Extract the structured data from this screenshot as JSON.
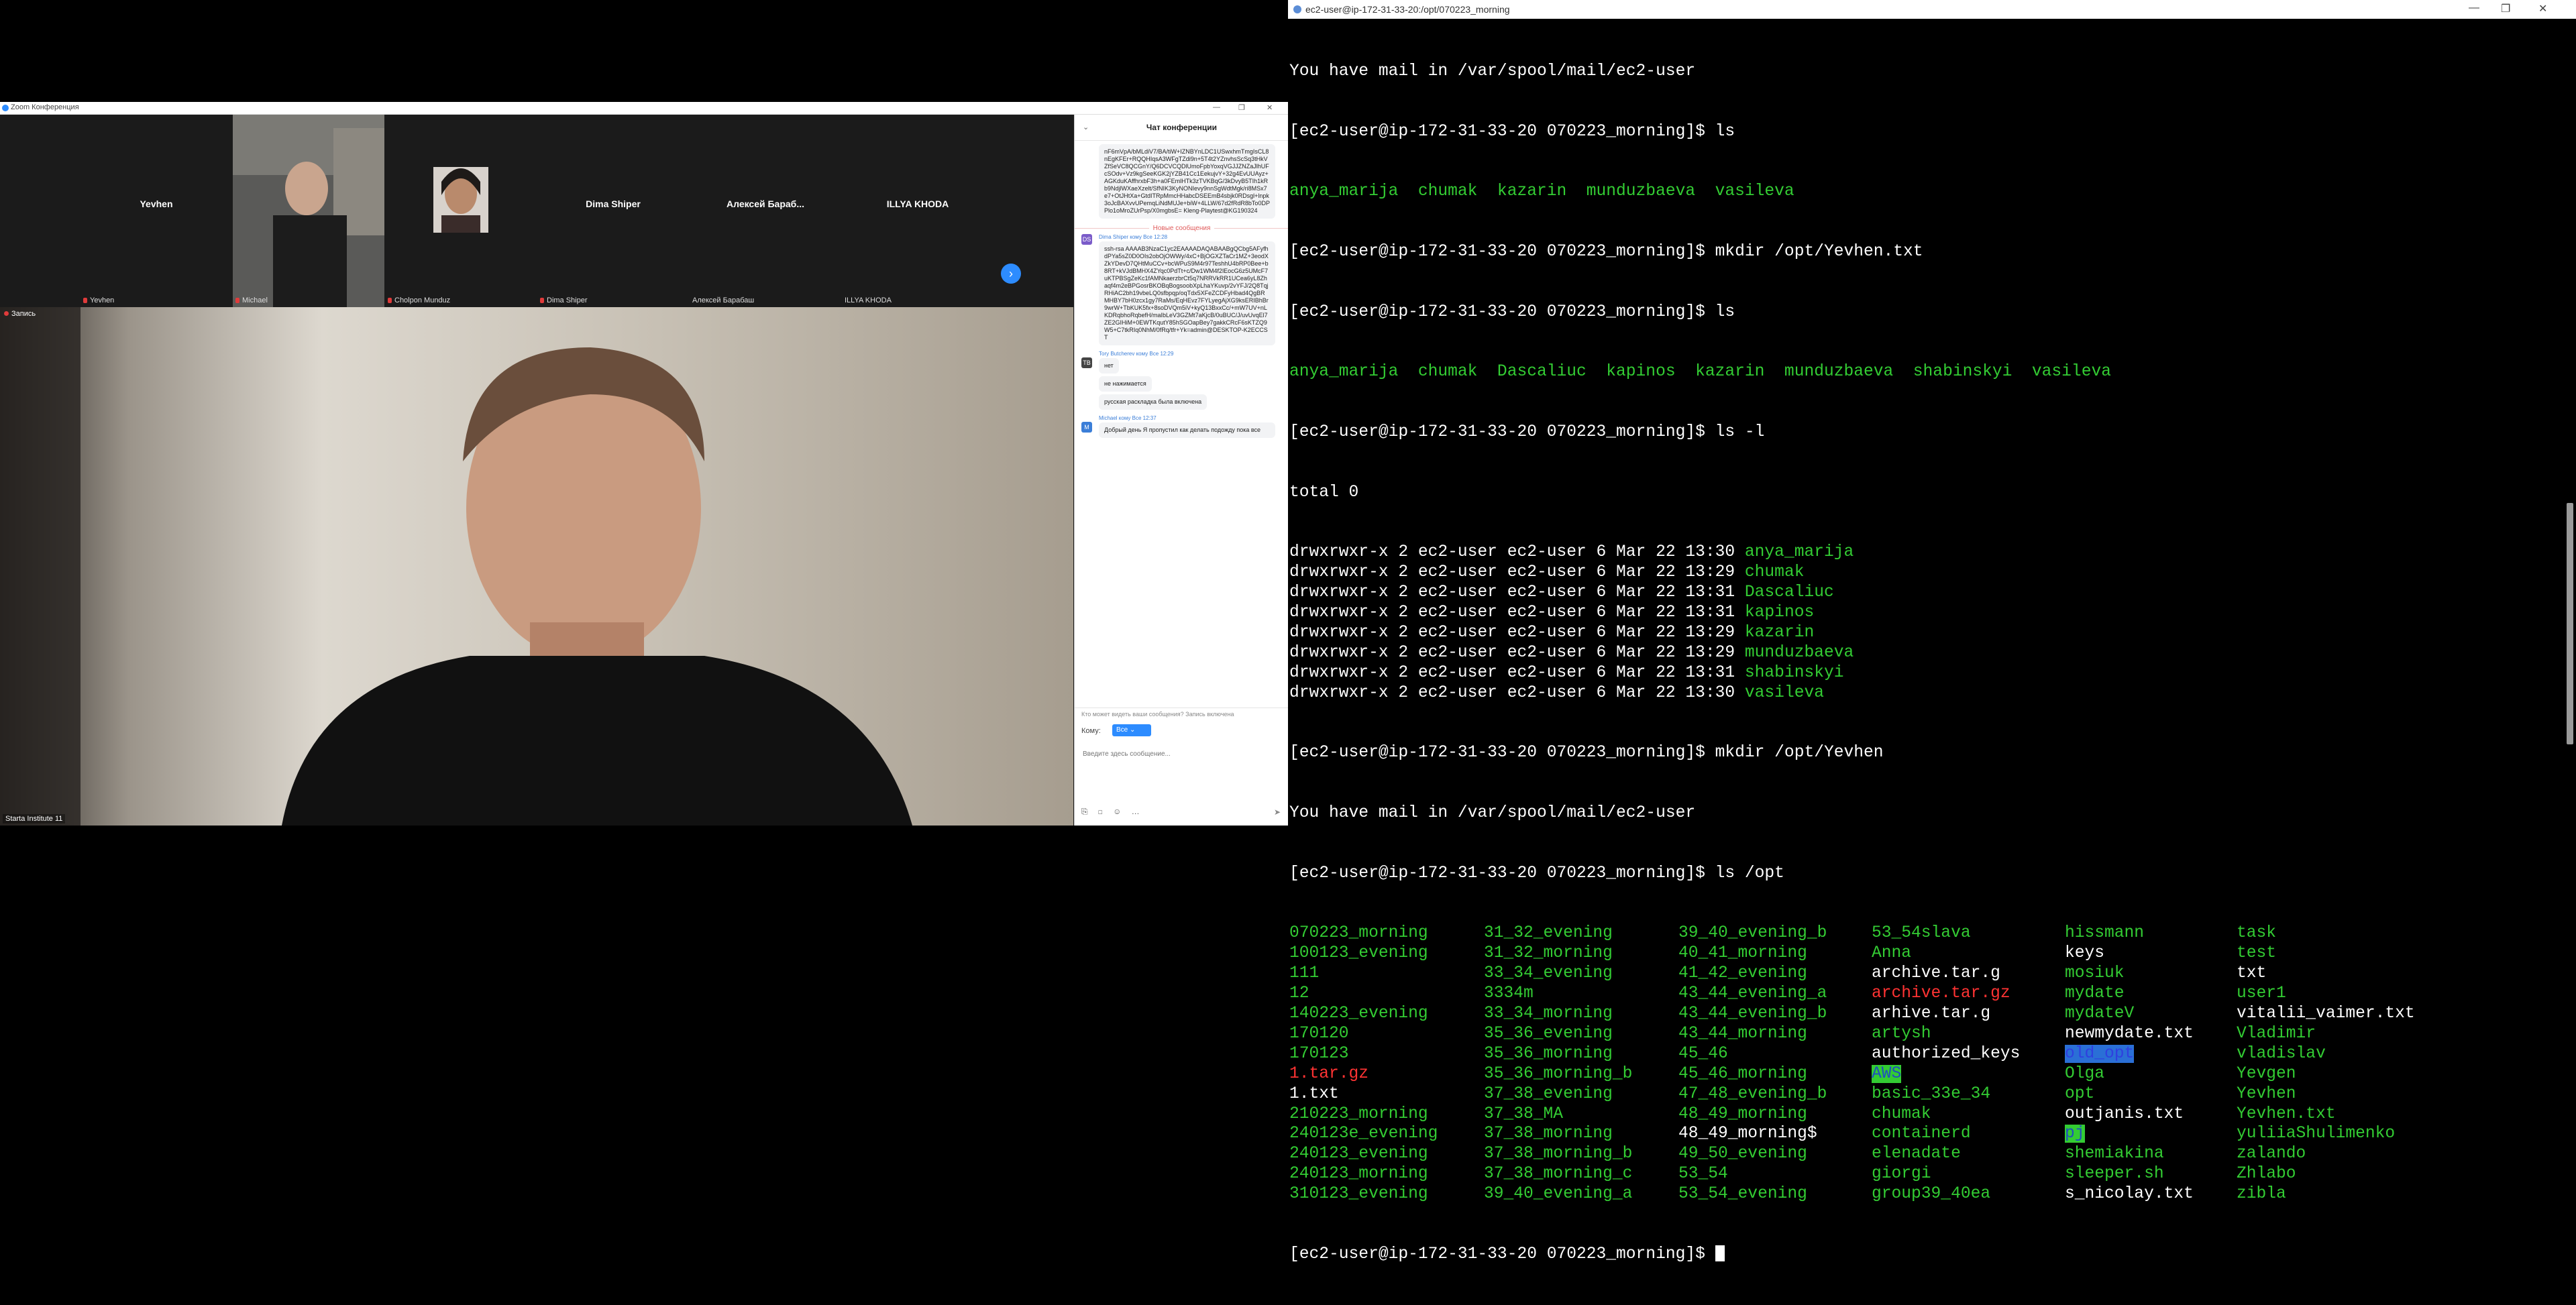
{
  "zoom": {
    "window_title": "Zoom Конференция",
    "participants": [
      {
        "name": "Yevhen",
        "label": "Yevhen",
        "muted": true
      },
      {
        "name": "",
        "label": "Michael",
        "muted": true
      },
      {
        "name": "",
        "label": "Cholpon Munduz",
        "muted": true
      },
      {
        "name": "Dima Shiper",
        "label": "Dima Shiper",
        "muted": true
      },
      {
        "name": "Алексей Бараб...",
        "label": "Алексей Барабаш",
        "muted": false
      },
      {
        "name": "ILLYA KHODA",
        "label": "ILLYA KHODA",
        "muted": false
      }
    ],
    "next_arrow": "›",
    "recording_label": "Запись",
    "speaker_name": "Starta Institute 11"
  },
  "chat": {
    "title": "Чат конференции",
    "collapse": "⌄",
    "first_key_block": "nF6mVpA/bMLdiV7/BA/tiW+IZNBYnLDC1USwxhmTmgIsCL8nEgKFEr+RQQHIqsA3WFgTZdi9n+5T4t2YZnvhsScSq3tHkVZfSeVC8QCGnY/Q6DCVCQDlUmoFpbYoxqVGJJZNZaJlhUFcSOdv+Vz9kgSeeKGK2jYZB41Cc1EekujvY+32g4EvUUAyz+AGKduKAffhrxbF3h+a0FEmlHTk3zTVKBqG/3kDvyB5TIh1kRb9NdjlWXaeXzelt/SfNIK3KyNONIevy9nnSgWdtMgk/ri8MSx7e7+OtJHtXa+GtdITRpMmcHHabcDSEEmB4sbjk0RDsgl+lnpk3oJcBAXvvUPemqLiNdMUJe+biW+4LLW/67d2fRdR8bTo0DPPlo1oMroZUrPsp/X0mgbsE= Kleng-Playtest@KG190324",
    "new_messages": "Новые сообщения",
    "messages": [
      {
        "author": "Dima Shiper кому Все 12:28",
        "avatar": "DS",
        "avatar_color": "#7a5bc9",
        "texts": [
          "ssh-rsa AAAAB3NzaC1yc2EAAAADAQABAABgQCbg5AFyfhdPYa5sZ0D0OIs2obOjOWWy/4xC+BjOGXZTaCr1MZ+3eodXZkYDevD7QHtMuCCv+bcWPuS9M4r97TeshhU4bRP0Bee+b8RT+kVJdBMHX4ZYqc0PdTt+c/Dw1WM4f2lEocG6z5UMcF7uKTPBSgZeKc1fAMNkaerzbrCt5q7NRRVkRR1UCea6yL8Zhaqf4m2eBPGosrBKOBqBogsoobXpLhaYKuvp/2vYFJ/2Q8TqjRHiAC2bh19vbeLQ0sfbpqp/oqTdx5XFeZCDFyHbad4QgBRMHBY7bH0zcx1gy7RaMs/EqHEvz7FYLyegAjXG9ksERIBhBr9wrW+TbKUK5fx+8soDVQm5iV+kyQ13BxxCc/+mW7UV+nLKDRqbhoRqbefH/maIbLeV3GZMt7aKjcB/0uBUC/J/uvUvqEl7ZE2GIHiM+0EWTKqutY85hSGOapBey7gakkCRcF6sKTZQ9W5+C7tkRIq0NhM/0fRq/tfr+Yk=admin@DESKTOP-K2ECCST"
        ]
      },
      {
        "author": "Tory Butcherev кому Все 12:29",
        "avatar": "TB",
        "avatar_color": "#444444",
        "texts": [
          "нет",
          "не нажимается",
          "русская раскладка была включена"
        ]
      },
      {
        "author": "Michael кому Все 12:37",
        "avatar": "M",
        "avatar_color": "#3b7ed8",
        "texts": [
          "Добрый день Я пропустил как делать подожду пока все"
        ]
      }
    ],
    "notice": "Кто может видеть ваши сообщения? Запись включена",
    "to_label": "Кому:",
    "to_value": "Все ⌄",
    "input_placeholder": "Введите здесь сообщение...",
    "tools": "⎘ ◻ ☺ …",
    "send": "➤"
  },
  "terminal": {
    "title": "ec2-user@ip-172-31-33-20:/opt/070223_morning",
    "minimize": "—",
    "maximize": "❐",
    "close": "✕",
    "lines": [
      "You have mail in /var/spool/mail/ec2-user",
      "[ec2-user@ip-172-31-33-20 070223_morning]$ ls",
      "",
      "[ec2-user@ip-172-31-33-20 070223_morning]$ mkdir /opt/Yevhen.txt",
      "[ec2-user@ip-172-31-33-20 070223_morning]$ ls",
      "",
      "[ec2-user@ip-172-31-33-20 070223_morning]$ ls -l",
      "total 0"
    ],
    "ls1": "anya_marija  chumak  kazarin  munduzbaeva  vasileva",
    "ls2": "anya_marija  chumak  Dascaliuc  kapinos  kazarin  munduzbaeva  shabinskyi  vasileva",
    "ls_l_prefix": "drwxrwxr-x 2 ec2-user ec2-user 6 Mar 22 ",
    "ls_l": [
      {
        "time": "13:30",
        "name": "anya_marija"
      },
      {
        "time": "13:29",
        "name": "chumak"
      },
      {
        "time": "13:31",
        "name": "Dascaliuc"
      },
      {
        "time": "13:31",
        "name": "kapinos"
      },
      {
        "time": "13:29",
        "name": "kazarin"
      },
      {
        "time": "13:29",
        "name": "munduzbaeva"
      },
      {
        "time": "13:31",
        "name": "shabinskyi"
      },
      {
        "time": "13:30",
        "name": "vasileva"
      }
    ],
    "after_lines": [
      "[ec2-user@ip-172-31-33-20 070223_morning]$ mkdir /opt/Yevhen",
      "You have mail in /var/spool/mail/ec2-user",
      "[ec2-user@ip-172-31-33-20 070223_morning]$ ls /opt"
    ],
    "opt_columns": [
      [
        {
          "t": "070223_morning",
          "c": "g"
        },
        {
          "t": "100123_evening",
          "c": "g"
        },
        {
          "t": "111",
          "c": "g"
        },
        {
          "t": "12",
          "c": "g"
        },
        {
          "t": "140223_evening",
          "c": "g"
        },
        {
          "t": "170120",
          "c": "g"
        },
        {
          "t": "170123",
          "c": "g"
        },
        {
          "t": "1.tar.gz",
          "c": "r"
        },
        {
          "t": "1.txt",
          "c": "w"
        },
        {
          "t": "210223_morning",
          "c": "g"
        },
        {
          "t": "240123e_evening",
          "c": "g"
        },
        {
          "t": "240123_evening",
          "c": "g"
        },
        {
          "t": "240123_morning",
          "c": "g"
        },
        {
          "t": "310123_evening",
          "c": "g"
        }
      ],
      [
        {
          "t": "31_32_evening",
          "c": "g"
        },
        {
          "t": "31_32_morning",
          "c": "g"
        },
        {
          "t": "33_34_evening",
          "c": "g"
        },
        {
          "t": "3334m",
          "c": "g"
        },
        {
          "t": "33_34_morning",
          "c": "g"
        },
        {
          "t": "35_36_evening",
          "c": "g"
        },
        {
          "t": "35_36_morning",
          "c": "g"
        },
        {
          "t": "35_36_morning_b",
          "c": "g"
        },
        {
          "t": "37_38_evening",
          "c": "g"
        },
        {
          "t": "37_38_MA",
          "c": "g"
        },
        {
          "t": "37_38_morning",
          "c": "g"
        },
        {
          "t": "37_38_morning_b",
          "c": "g"
        },
        {
          "t": "37_38_morning_c",
          "c": "g"
        },
        {
          "t": "39_40_evening_a",
          "c": "g"
        }
      ],
      [
        {
          "t": "39_40_evening_b",
          "c": "g"
        },
        {
          "t": "40_41_morning",
          "c": "g"
        },
        {
          "t": "41_42_evening",
          "c": "g"
        },
        {
          "t": "43_44_evening_a",
          "c": "g"
        },
        {
          "t": "43_44_evening_b",
          "c": "g"
        },
        {
          "t": "43_44_morning",
          "c": "g"
        },
        {
          "t": "45_46",
          "c": "g"
        },
        {
          "t": "45_46_morning",
          "c": "g"
        },
        {
          "t": "47_48_evening_b",
          "c": "g"
        },
        {
          "t": "48_49_morning",
          "c": "g"
        },
        {
          "t": "48_49_morning$",
          "c": "w"
        },
        {
          "t": "49_50_evening",
          "c": "g"
        },
        {
          "t": "53_54",
          "c": "g"
        },
        {
          "t": "53_54_evening",
          "c": "g"
        }
      ],
      [
        {
          "t": "53_54slava",
          "c": "g"
        },
        {
          "t": "Anna",
          "c": "g"
        },
        {
          "t": "archive.tar.g",
          "c": "w"
        },
        {
          "t": "archive.tar.gz",
          "c": "r"
        },
        {
          "t": "arhive.tar.g",
          "c": "w"
        },
        {
          "t": "artysh",
          "c": "g"
        },
        {
          "t": "authorized_keys",
          "c": "w"
        },
        {
          "t": "AWS",
          "c": "hlg"
        },
        {
          "t": "basic_33e_34",
          "c": "g"
        },
        {
          "t": "chumak",
          "c": "g"
        },
        {
          "t": "containerd",
          "c": "g"
        },
        {
          "t": "elenadate",
          "c": "g"
        },
        {
          "t": "giorgi",
          "c": "g"
        },
        {
          "t": "group39_40ea",
          "c": "g"
        }
      ],
      [
        {
          "t": "hissmann",
          "c": "g"
        },
        {
          "t": "keys",
          "c": "w"
        },
        {
          "t": "mosiuk",
          "c": "g"
        },
        {
          "t": "mydate",
          "c": "g"
        },
        {
          "t": "mydateV",
          "c": "g"
        },
        {
          "t": "newmydate.txt",
          "c": "w"
        },
        {
          "t": "old_opt",
          "c": "hl"
        },
        {
          "t": "Olga",
          "c": "g"
        },
        {
          "t": "opt",
          "c": "g"
        },
        {
          "t": "outjanis.txt",
          "c": "w"
        },
        {
          "t": "pj",
          "c": "hlg"
        },
        {
          "t": "shemiakina",
          "c": "g"
        },
        {
          "t": "sleeper.sh",
          "c": "g"
        },
        {
          "t": "s_nicolay.txt",
          "c": "w"
        }
      ],
      [
        {
          "t": "task",
          "c": "g"
        },
        {
          "t": "test",
          "c": "g"
        },
        {
          "t": "txt",
          "c": "w"
        },
        {
          "t": "user1",
          "c": "g"
        },
        {
          "t": "vitalii_vaimer.txt",
          "c": "w"
        },
        {
          "t": "Vladimir",
          "c": "g"
        },
        {
          "t": "vladislav",
          "c": "g"
        },
        {
          "t": "Yevgen",
          "c": "g"
        },
        {
          "t": "Yevhen",
          "c": "g"
        },
        {
          "t": "Yevhen.txt",
          "c": "g"
        },
        {
          "t": "yuliiaShulimenko",
          "c": "g"
        },
        {
          "t": "zalando",
          "c": "g"
        },
        {
          "t": "Zhlabo",
          "c": "g"
        },
        {
          "t": "zibla",
          "c": "g"
        }
      ]
    ],
    "final_prompt": "[ec2-user@ip-172-31-33-20 070223_morning]$ "
  }
}
